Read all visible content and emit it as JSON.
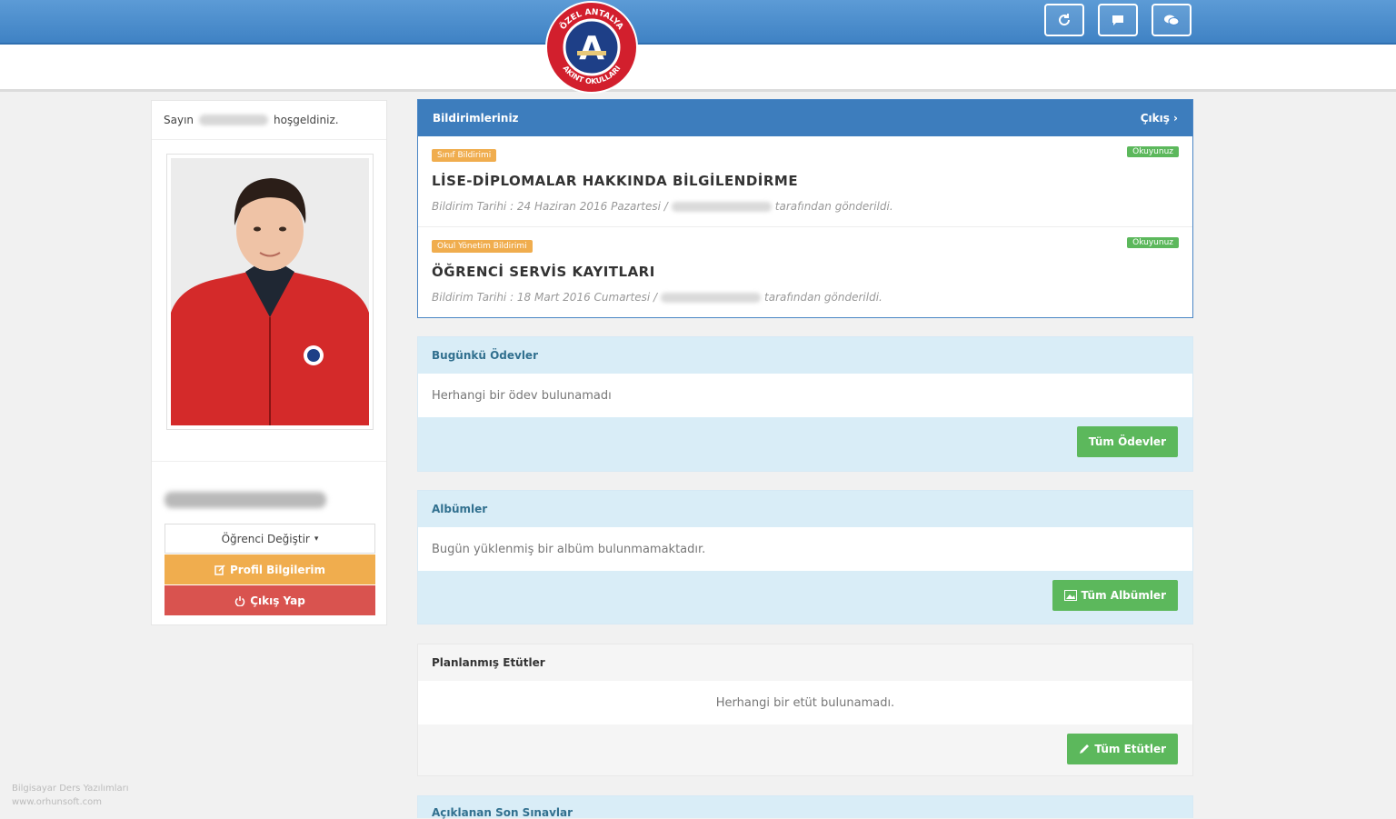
{
  "header": {
    "logo_text_top": "ÖZEL ANTALYA",
    "logo_text_bottom": "AKINT OKULLARI",
    "logo_letter": "A",
    "buttons": [
      {
        "icon": "refresh-icon"
      },
      {
        "icon": "message-icon"
      },
      {
        "icon": "chat-icon"
      }
    ]
  },
  "sidebar": {
    "welcome_prefix": "Sayın",
    "welcome_suffix": "hoşgeldiniz.",
    "change_student_label": "Öğrenci Değiştir",
    "profile_label": "Profil Bilgilerim",
    "logout_label": "Çıkış Yap"
  },
  "notifications": {
    "title": "Bildirimleriniz",
    "exit_label": "Çıkış",
    "items": [
      {
        "tag": "Sınıf Bildirimi",
        "read_label": "Okuyunuz",
        "title": "LİSE-DİPLOMALAR HAKKINDA BİLGİLENDİRME",
        "date_text": "Bildirim Tarihi : 24 Haziran 2016 Pazartesi /",
        "sent_by": "tarafından gönderildi."
      },
      {
        "tag": "Okul Yönetim Bildirimi",
        "read_label": "Okuyunuz",
        "title": "ÖĞRENCİ SERVİS KAYITLARI",
        "date_text": "Bildirim Tarihi : 18 Mart 2016 Cumartesi /",
        "sent_by": "tarafından gönderildi."
      }
    ]
  },
  "homework": {
    "title": "Bugünkü Ödevler",
    "empty_text": "Herhangi bir ödev bulunamadı",
    "button_label": "Tüm Ödevler"
  },
  "albums": {
    "title": "Albümler",
    "empty_text": "Bugün yüklenmiş bir albüm bulunmamaktadır.",
    "button_label": "Tüm Albümler"
  },
  "etuts": {
    "title": "Planlanmış Etütler",
    "empty_text": "Herhangi bir etüt bulunamadı.",
    "button_label": "Tüm Etütler"
  },
  "exams": {
    "title": "Açıklanan Son Sınavlar"
  },
  "footer": {
    "line1": "Bilgisayar Ders Yazılımları",
    "line2": "www.orhunsoft.com"
  },
  "colors": {
    "brand_blue": "#3d7dbd",
    "success": "#5cb85c",
    "warning": "#f0ad4e",
    "danger": "#d9534f",
    "info_bg": "#d9edf7"
  }
}
